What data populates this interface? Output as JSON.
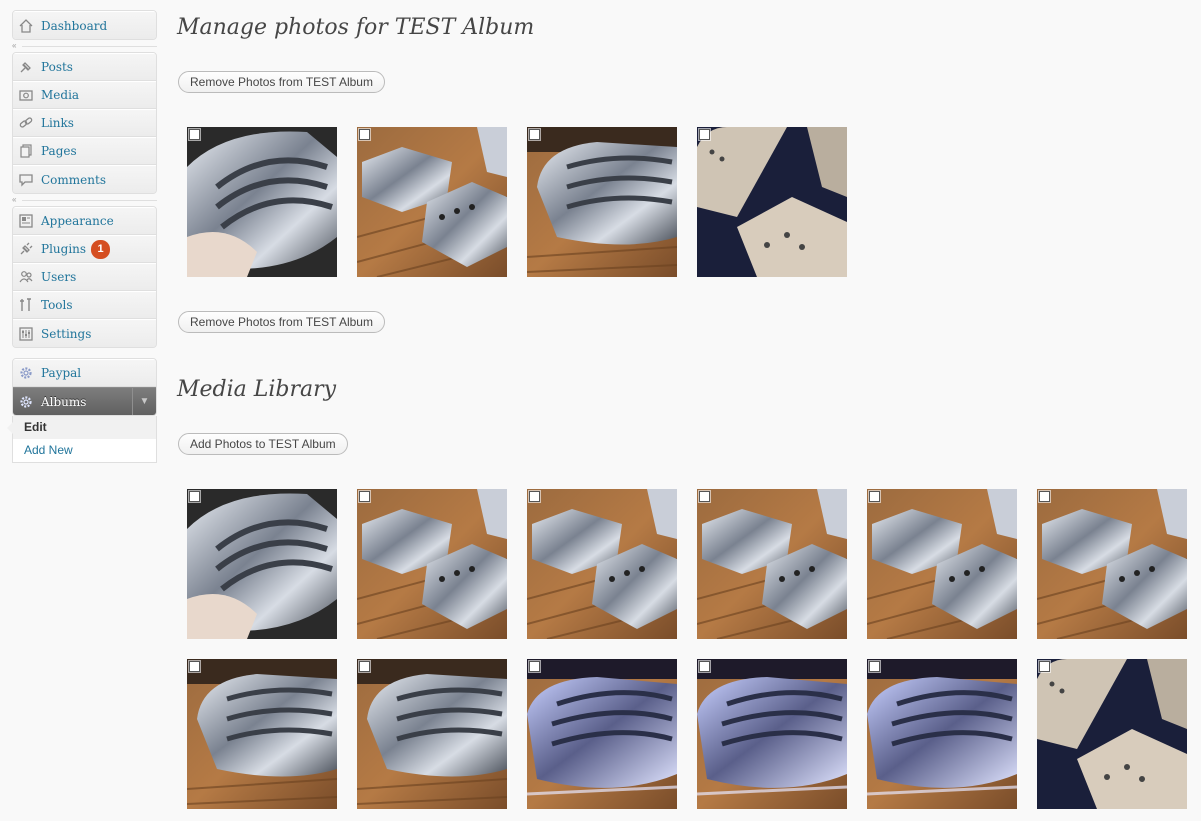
{
  "sidebar": {
    "group1": [
      {
        "label": "Dashboard",
        "icon": "dashboard-icon"
      }
    ],
    "group2": [
      {
        "label": "Posts",
        "icon": "pushpin-icon"
      },
      {
        "label": "Media",
        "icon": "media-icon"
      },
      {
        "label": "Links",
        "icon": "link-icon"
      },
      {
        "label": "Pages",
        "icon": "pages-icon"
      },
      {
        "label": "Comments",
        "icon": "comment-icon"
      }
    ],
    "group3": [
      {
        "label": "Appearance",
        "icon": "appearance-icon"
      },
      {
        "label": "Plugins",
        "icon": "plugin-icon",
        "badge": "1"
      },
      {
        "label": "Users",
        "icon": "users-icon"
      },
      {
        "label": "Tools",
        "icon": "tools-icon"
      },
      {
        "label": "Settings",
        "icon": "settings-icon"
      }
    ],
    "group4": [
      {
        "label": "Paypal",
        "icon": "gear-icon"
      },
      {
        "label": "Albums",
        "icon": "gear-icon",
        "active": true
      }
    ],
    "albums_submenu": [
      {
        "label": "Edit",
        "current": true
      },
      {
        "label": "Add New",
        "current": false
      }
    ]
  },
  "album_section": {
    "title": "Manage photos for TEST Album",
    "remove_button_top": "Remove Photos from TEST Album",
    "remove_button_bottom": "Remove Photos from TEST Album",
    "photos": [
      "cover-angled",
      "plate-pair",
      "cover-side",
      "plate-silver"
    ]
  },
  "library_section": {
    "title": "Media Library",
    "add_button": "Add Photos to TEST Album",
    "photos": [
      "cover-angled",
      "plate-pair",
      "plate-pair",
      "plate-pair",
      "plate-pair",
      "plate-pair",
      "cover-side",
      "cover-side",
      "cover-blue",
      "cover-blue",
      "cover-blue",
      "plate-silver"
    ]
  },
  "colors": {
    "link": "#21759b",
    "badge": "#d54e21",
    "active_menu": "#6d6d6d"
  }
}
